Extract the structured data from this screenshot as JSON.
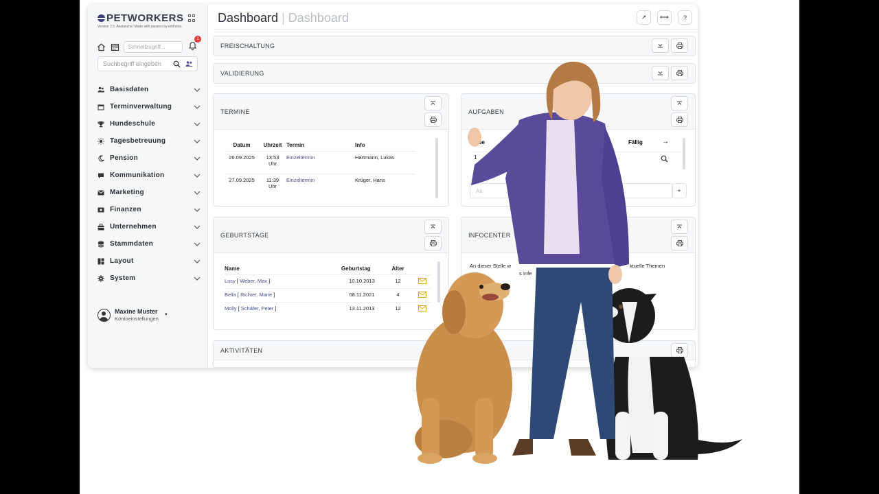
{
  "app": {
    "brand": "PETWORKERS",
    "version": "Version 2.5. Avalanche. Made with passion by eminova."
  },
  "sidebar": {
    "quick_placeholder": "Schnellzugriff...",
    "notification_count": "1",
    "search_placeholder": "Suchbegriff eingeben",
    "items": [
      {
        "label": "Basisdaten",
        "icon": "users-icon"
      },
      {
        "label": "Terminverwaltung",
        "icon": "calendar-icon"
      },
      {
        "label": "Hundeschule",
        "icon": "trophy-icon"
      },
      {
        "label": "Tagesbetreuung",
        "icon": "sun-icon"
      },
      {
        "label": "Pension",
        "icon": "moon-icon"
      },
      {
        "label": "Kommunikation",
        "icon": "chat-icon"
      },
      {
        "label": "Marketing",
        "icon": "mail-icon"
      },
      {
        "label": "Finanzen",
        "icon": "money-icon"
      },
      {
        "label": "Unternehmen",
        "icon": "building-icon"
      },
      {
        "label": "Stammdaten",
        "icon": "database-icon"
      },
      {
        "label": "Layout",
        "icon": "layout-icon"
      },
      {
        "label": "System",
        "icon": "gear-icon"
      }
    ],
    "user": {
      "name": "Maxine Muster",
      "sub": "Kontoeinstellungen"
    }
  },
  "header": {
    "title": "Dashboard",
    "separator": "|",
    "subtitle": "Dashboard",
    "actions": [
      {
        "name": "external-link-button",
        "glyph": "↗"
      },
      {
        "name": "split-view-button",
        "glyph": "⟷"
      },
      {
        "name": "help-button",
        "glyph": "?"
      }
    ]
  },
  "panels": {
    "freischaltung": {
      "title": "FREISCHALTUNG"
    },
    "validierung": {
      "title": "VALIDIERUNG"
    },
    "termine": {
      "title": "TERMINE",
      "columns": [
        "Datum",
        "Uhrzeit",
        "Termin",
        "Info"
      ],
      "rows": [
        {
          "datum": "26.09.2025",
          "uhrzeit": "13:53 Uhr",
          "termin": "Einzeltermin",
          "info": "Hartmann, Lukas"
        },
        {
          "datum": "27.09.2025",
          "uhrzeit": "11:39 Uhr",
          "termin": "Einzeltermin",
          "info": "Krüger, Hans"
        }
      ]
    },
    "aufgaben": {
      "title": "AUFGABEN",
      "col_partial": "abe",
      "col_due": "Fällig",
      "col_arrow": "→",
      "row_partial": "1",
      "input_placeholder": "Au",
      "add_glyph": "+"
    },
    "geburtstage": {
      "title": "GEBURTSTAGE",
      "columns": [
        "Name",
        "Geburtstag",
        "Alter"
      ],
      "rows": [
        {
          "name": "Lucy",
          "owner": "Weber, Max",
          "date": "10.10.2013",
          "age": "12"
        },
        {
          "name": "Bella",
          "owner": "Richter, Marie",
          "date": "08.11.2021",
          "age": "4"
        },
        {
          "name": "Molly",
          "owner": "Schäfer, Peter",
          "date": "13.11.2013",
          "age": "12"
        }
      ]
    },
    "infocenter": {
      "title": "INFOCENTER",
      "text_left": "An dieser Stelle w",
      "text_right": "ktuelle Themen",
      "text_line2": "s Infe"
    },
    "aktivitaeten": {
      "title": "AKTIVITÄTEN"
    }
  },
  "colors": {
    "accent": "#4a4d8f",
    "jacket": "#5a4a9a",
    "badge": "#e03a3a",
    "mail": "#e8a21a"
  }
}
